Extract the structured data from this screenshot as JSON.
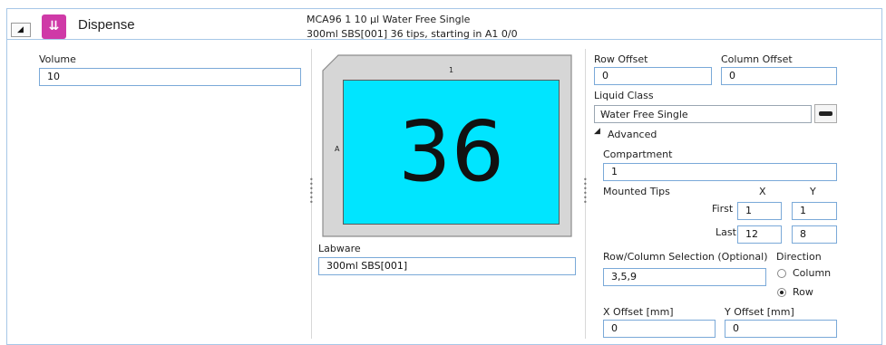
{
  "header": {
    "title": "Dispense",
    "icon": "dispense-arrows-icon",
    "icon_glyph": "⇊",
    "icon_color": "#cf3aa7",
    "collapse_glyph": "◢",
    "description_line1": "MCA96 1 10 µl Water Free Single",
    "description_line2": "300ml SBS[001] 36 tips, starting in A1 0/0"
  },
  "volume": {
    "label": "Volume",
    "value": "10"
  },
  "plate": {
    "column_label": "1",
    "row_label": "A",
    "tip_count": "36",
    "well_color": "#00e5ff"
  },
  "labware": {
    "label": "Labware",
    "value": "300ml SBS[001]"
  },
  "offsets": {
    "row_label": "Row Offset",
    "row_value": "0",
    "column_label": "Column Offset",
    "column_value": "0"
  },
  "liquid_class": {
    "label": "Liquid Class",
    "selected": "Water Free Single",
    "chevron": "⌄"
  },
  "advanced": {
    "toggle_glyph": "◢",
    "label": "Advanced",
    "compartment_label": "Compartment",
    "compartment_value": "1",
    "mounted_tips_label": "Mounted Tips",
    "x_header": "X",
    "y_header": "Y",
    "first_label": "First",
    "first_x": "1",
    "first_y": "1",
    "last_label": "Last",
    "last_x": "12",
    "last_y": "8",
    "selection_label": "Row/Column Selection (Optional)",
    "selection_value": "3,5,9",
    "direction_label": "Direction",
    "direction_options": [
      "Column",
      "Row"
    ],
    "direction_selected": "Row",
    "x_offset_label": "X Offset [mm]",
    "x_offset_value": "0",
    "y_offset_label": "Y Offset [mm]",
    "y_offset_value": "0"
  },
  "colors": {
    "border_blue": "#a7c7e7",
    "input_border": "#7aa9d8"
  }
}
